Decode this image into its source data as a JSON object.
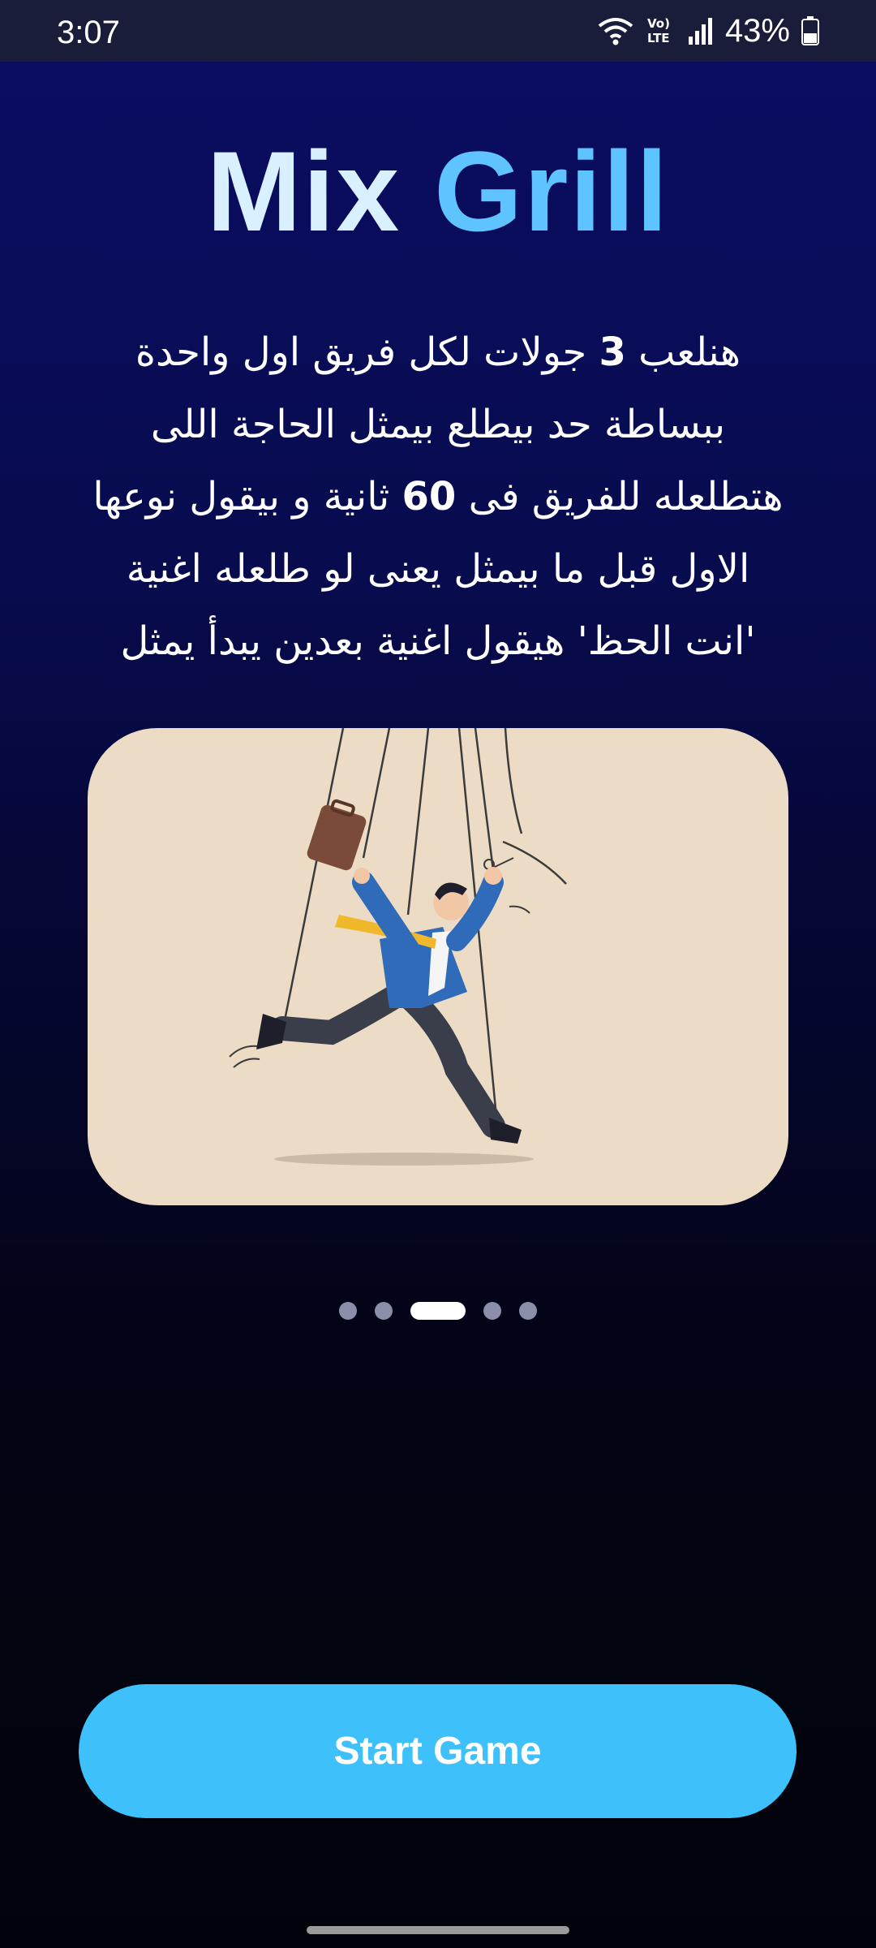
{
  "status_bar": {
    "time": "3:07",
    "battery_percent": "43%",
    "battery_level": 0.43,
    "icons": [
      "wifi-icon",
      "volte-icon",
      "signal-icon",
      "battery-icon"
    ]
  },
  "title": {
    "word1": "Mix",
    "word2": "Grill"
  },
  "description": {
    "line1_a": "هنلعب ",
    "line1_num": "3",
    "line1_b": " جولات لكل فريق اول واحدة",
    "line2": "ببساطة حد بيطلع بيمثل الحاجة اللى",
    "line3_a": "هتطلعله للفريق فى ",
    "line3_num": "60",
    "line3_b": " ثانية و بيقول نوعها",
    "line4": "الاول قبل ما بيمثل يعنى لو طلعله اغنية",
    "line5": "'انت الحظ' هيقول اغنية بعدين يبدأ يمثل"
  },
  "carousel": {
    "total_pages": 5,
    "active_index": 2
  },
  "start_button": {
    "label": "Start Game"
  },
  "colors": {
    "accent": "#3ec1fa",
    "title_light": "#d8f0ff",
    "title_blue": "#5ec3ff",
    "card_bg": "#ecdcc6"
  }
}
